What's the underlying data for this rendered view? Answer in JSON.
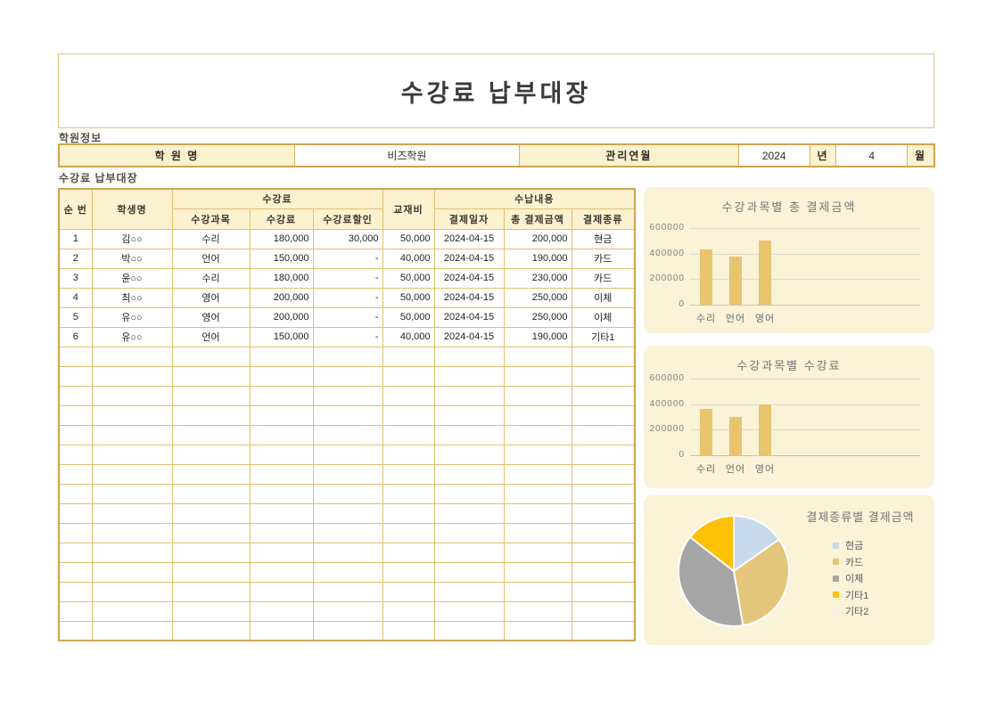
{
  "page": {
    "title": "수강료 납부대장"
  },
  "info_section": {
    "label": "학원정보",
    "academy_name_label": "학 원 명",
    "academy_name_value": "비즈학원",
    "manage_month_label": "관리연월",
    "year_value": "2024",
    "year_suffix": "년",
    "month_value": "4",
    "month_suffix": "월"
  },
  "ledger": {
    "label": "수강료 납부대장",
    "header": {
      "no": "순 번",
      "student": "학생명",
      "tuition_group": "수강료",
      "subject": "수강과목",
      "tuition": "수강료",
      "discount": "수강료할인",
      "book_fee": "교재비",
      "payment_group": "수납내용",
      "pay_date": "결제일자",
      "total_amount": "총 결제금액",
      "pay_type": "결제종류"
    },
    "rows": [
      {
        "no": "1",
        "student": "김○○",
        "subject": "수리",
        "tuition": "180,000",
        "discount": "30,000",
        "book": "50,000",
        "date": "2024-04-15",
        "total": "200,000",
        "type": "현금"
      },
      {
        "no": "2",
        "student": "박○○",
        "subject": "언어",
        "tuition": "150,000",
        "discount": "-",
        "book": "40,000",
        "date": "2024-04-15",
        "total": "190,000",
        "type": "카드"
      },
      {
        "no": "3",
        "student": "윤○○",
        "subject": "수리",
        "tuition": "180,000",
        "discount": "-",
        "book": "50,000",
        "date": "2024-04-15",
        "total": "230,000",
        "type": "카드"
      },
      {
        "no": "4",
        "student": "최○○",
        "subject": "영어",
        "tuition": "200,000",
        "discount": "-",
        "book": "50,000",
        "date": "2024-04-15",
        "total": "250,000",
        "type": "이체"
      },
      {
        "no": "5",
        "student": "유○○",
        "subject": "영어",
        "tuition": "200,000",
        "discount": "-",
        "book": "50,000",
        "date": "2024-04-15",
        "total": "250,000",
        "type": "이체"
      },
      {
        "no": "6",
        "student": "유○○",
        "subject": "언어",
        "tuition": "150,000",
        "discount": "-",
        "book": "40,000",
        "date": "2024-04-15",
        "total": "190,000",
        "type": "기타1"
      }
    ],
    "empty_row_count": 15
  },
  "chart_data": [
    {
      "type": "bar",
      "title": "수강과목별 총 결제금액",
      "categories": [
        "수리",
        "언어",
        "영어"
      ],
      "values": [
        430000,
        380000,
        500000
      ],
      "xlabel": "",
      "ylabel": "",
      "ylim": [
        0,
        600000
      ],
      "yticks": [
        0,
        200000,
        400000,
        600000
      ],
      "grid": true,
      "legend_position": "none",
      "bar_color": "#e8c46d"
    },
    {
      "type": "bar",
      "title": "수강과목별 수강료",
      "categories": [
        "수리",
        "언어",
        "영어"
      ],
      "values": [
        360000,
        300000,
        400000
      ],
      "xlabel": "",
      "ylabel": "",
      "ylim": [
        0,
        600000
      ],
      "yticks": [
        0,
        200000,
        400000,
        600000
      ],
      "grid": true,
      "legend_position": "none",
      "bar_color": "#e8c46d"
    },
    {
      "type": "pie",
      "title": "결제종류별 결제금액",
      "labels": [
        "현금",
        "카드",
        "이체",
        "기타1",
        "기타2"
      ],
      "values": [
        200000,
        420000,
        500000,
        190000,
        0
      ],
      "colors": [
        "#c7d9ed",
        "#e4c57c",
        "#a5a5a5",
        "#fcc004",
        "#f3f1e8"
      ],
      "legend_position": "right"
    }
  ],
  "colors": {
    "accent_gold_border": "#cfa452",
    "grid_gold": "#e2c06c",
    "header_fill": "#fcf2d0",
    "panel_fill": "#faf3d8",
    "bar_fill": "#e8c46d"
  }
}
